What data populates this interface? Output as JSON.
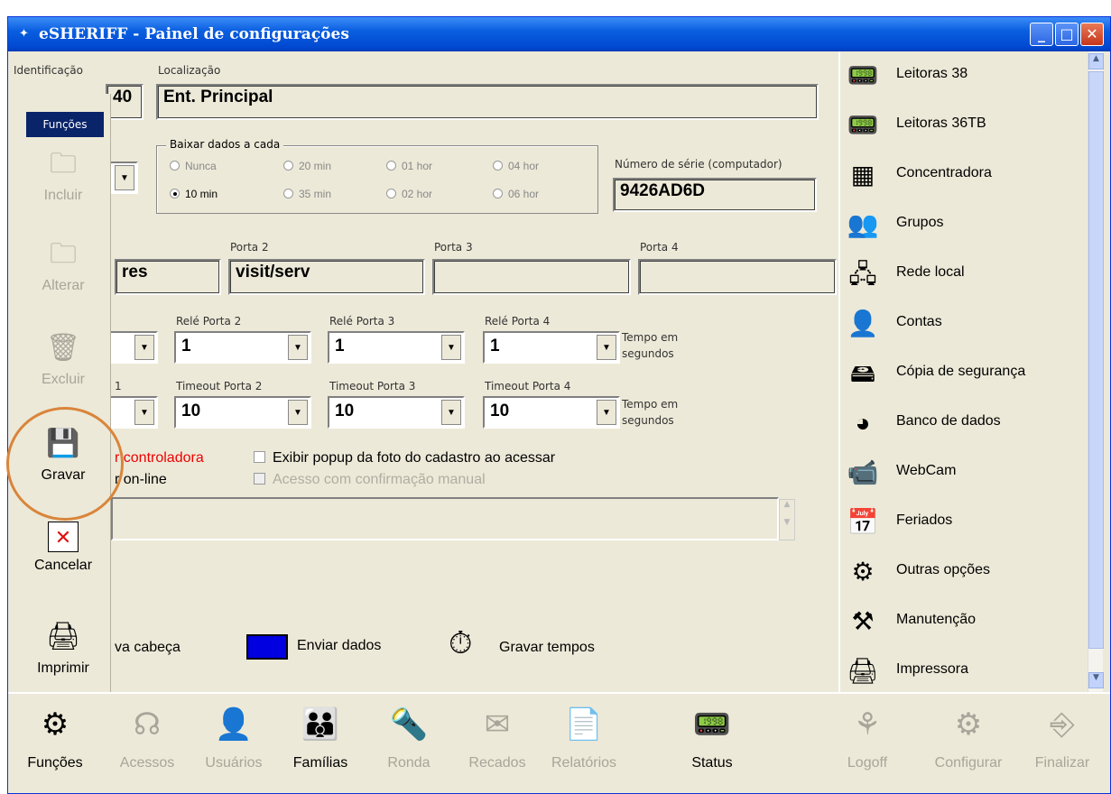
{
  "window": {
    "title": "eSHERIFF - Painel de configurações"
  },
  "labels": {
    "identificacao": "Identificação",
    "localizacao": "Localização",
    "baixar": "Baixar dados a cada",
    "numero_serie": "Número de série (computador)",
    "porta2": "Porta 2",
    "porta3": "Porta 3",
    "porta4": "Porta 4",
    "rele2": "Relé Porta 2",
    "rele3": "Relé Porta 3",
    "rele4": "Relé Porta 4",
    "timeout2": "Timeout Porta 2",
    "timeout3": "Timeout Porta 3",
    "timeout4": "Timeout Porta 4",
    "tempo_em": "Tempo em",
    "segundos": "segundos",
    "rele1_frag": "1"
  },
  "fields": {
    "identificacao": "40",
    "localizacao": "Ent. Principal",
    "numero_serie": "9426AD6D",
    "porta1": "res",
    "porta2": "visit/serv",
    "porta3": "",
    "porta4": ""
  },
  "radios": [
    {
      "label": "Nunca",
      "selected": false
    },
    {
      "label": "20 min",
      "selected": false
    },
    {
      "label": "01 hor",
      "selected": false
    },
    {
      "label": "04 hor",
      "selected": false
    },
    {
      "label": "10 min",
      "selected": true
    },
    {
      "label": "35 min",
      "selected": false
    },
    {
      "label": "02 hor",
      "selected": false
    },
    {
      "label": "06 hor",
      "selected": false
    }
  ],
  "combos": {
    "rele2": "1",
    "rele3": "1",
    "rele4": "1",
    "timeout2": "10",
    "timeout3": "10",
    "timeout4": "10"
  },
  "checks": {
    "controladora": "r controladora",
    "online": "r on-line",
    "popup": "Exibir popup da foto do cadastro ao acessar",
    "confirmacao": "Acesso com confirmação manual"
  },
  "actions": {
    "cabeca": "va cabeça",
    "enviar": "Enviar dados",
    "gravar_tempos": "Gravar tempos"
  },
  "funcs": {
    "header": "Funções",
    "items": [
      {
        "label": "Incluir"
      },
      {
        "label": "Alterar"
      },
      {
        "label": "Excluir"
      },
      {
        "label": "Gravar"
      },
      {
        "label": "Cancelar"
      },
      {
        "label": "Imprimir"
      }
    ]
  },
  "right": {
    "items": [
      {
        "label": "Leitoras 38"
      },
      {
        "label": "Leitoras 36TB"
      },
      {
        "label": "Concentradora"
      },
      {
        "label": "Grupos"
      },
      {
        "label": "Rede local"
      },
      {
        "label": "Contas"
      },
      {
        "label": "Cópia de segurança"
      },
      {
        "label": "Banco de dados"
      },
      {
        "label": "WebCam"
      },
      {
        "label": "Feriados"
      },
      {
        "label": "Outras opções"
      },
      {
        "label": "Manutenção"
      },
      {
        "label": "Impressora"
      }
    ]
  },
  "bottom": {
    "items": [
      {
        "label": "Funções"
      },
      {
        "label": "Acessos"
      },
      {
        "label": "Usuários"
      },
      {
        "label": "Famílias"
      },
      {
        "label": "Ronda"
      },
      {
        "label": "Recados"
      },
      {
        "label": "Relatórios"
      },
      {
        "label": "Status"
      },
      {
        "label": "Logoff"
      },
      {
        "label": "Configurar"
      },
      {
        "label": "Finalizar"
      }
    ]
  }
}
